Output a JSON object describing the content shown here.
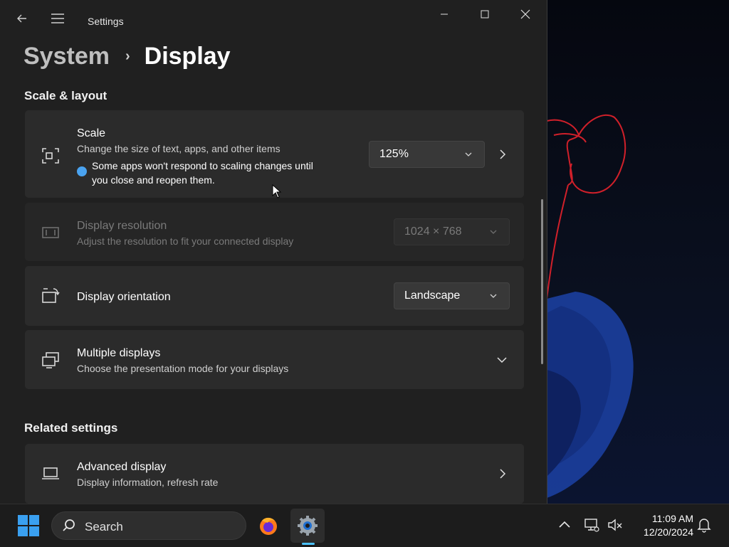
{
  "window": {
    "app_title": "Settings"
  },
  "breadcrumb": {
    "parent": "System",
    "separator": "›",
    "current": "Display"
  },
  "sections": {
    "scale_layout": "Scale & layout",
    "related": "Related settings"
  },
  "scale": {
    "title": "Scale",
    "subtitle": "Change the size of text, apps, and other items",
    "info": "Some apps won't respond to scaling changes until you close and reopen them.",
    "value": "125%"
  },
  "resolution": {
    "title": "Display resolution",
    "subtitle": "Adjust the resolution to fit your connected display",
    "value": "1024 × 768"
  },
  "orientation": {
    "title": "Display orientation",
    "value": "Landscape"
  },
  "multiple_displays": {
    "title": "Multiple displays",
    "subtitle": "Choose the presentation mode for your displays"
  },
  "advanced_display": {
    "title": "Advanced display",
    "subtitle": "Display information, refresh rate"
  },
  "taskbar": {
    "search_label": "Search",
    "time": "11:09 AM",
    "date": "12/20/2024"
  },
  "colors": {
    "accent": "#4cc2ff",
    "info": "#4aa3f0",
    "window_bg": "#202020",
    "card_bg": "#2b2b2b",
    "doodle": "#d0202a"
  }
}
